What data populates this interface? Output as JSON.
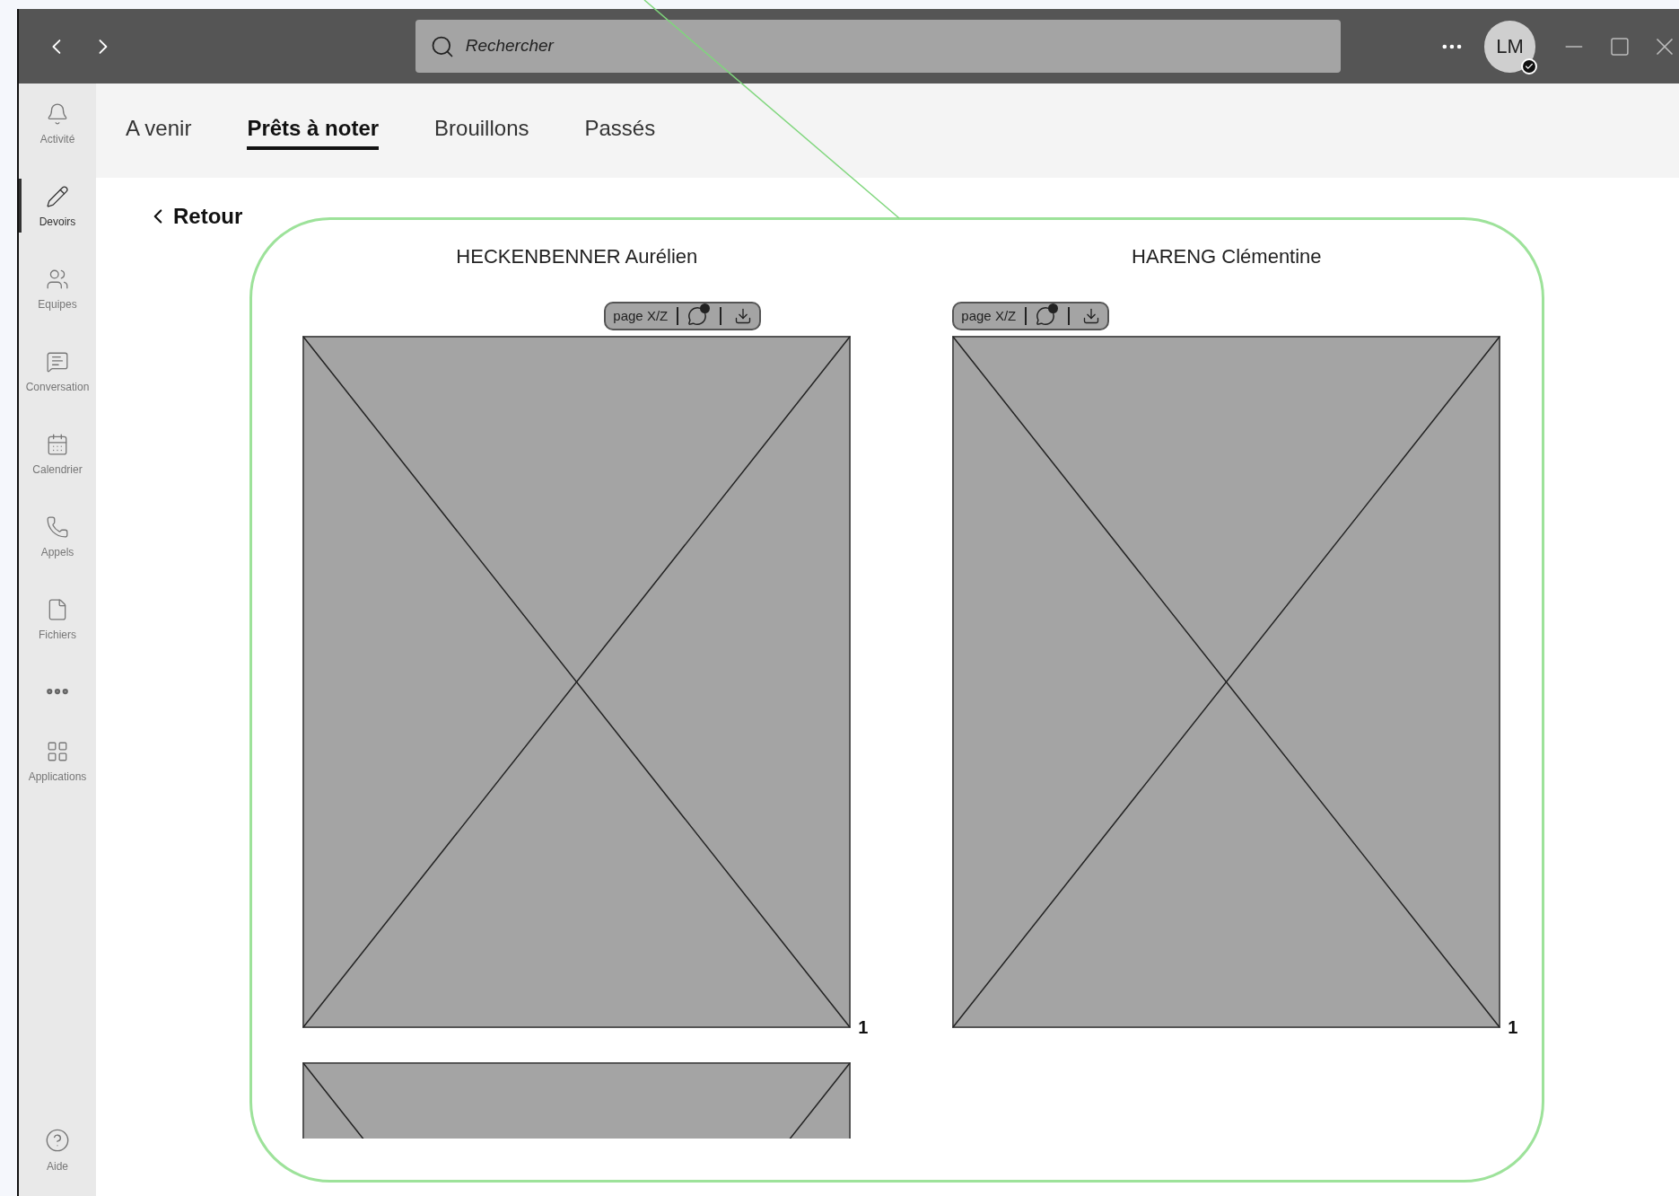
{
  "title_bar": {
    "search": {
      "placeholder": "Rechercher"
    },
    "avatar": {
      "initials": "LM"
    }
  },
  "sidebar": {
    "items": [
      {
        "label": "Activité",
        "selected": false
      },
      {
        "label": "Devoirs",
        "selected": true
      },
      {
        "label": "Equipes",
        "selected": false
      },
      {
        "label": "Conversation",
        "selected": false
      },
      {
        "label": "Calendrier",
        "selected": false
      },
      {
        "label": "Appels",
        "selected": false
      },
      {
        "label": "Fichiers",
        "selected": false
      }
    ],
    "more_items": [
      {
        "label": "Applications",
        "selected": false
      }
    ],
    "help": {
      "label": "Aide"
    }
  },
  "tabs": [
    {
      "label": "A venir",
      "selected": false
    },
    {
      "label": "Prêts à noter",
      "selected": true
    },
    {
      "label": "Brouillons",
      "selected": false
    },
    {
      "label": "Passés",
      "selected": false
    }
  ],
  "back": {
    "label": "Retour"
  },
  "submissions": [
    {
      "student": "HECKENBENNER Aurélien",
      "page_label": "page X/Z",
      "pages": [
        {
          "kind": "full",
          "number": "1"
        },
        {
          "kind": "partial"
        }
      ]
    },
    {
      "student": "HARENG Clémentine",
      "page_label": "page X/Z",
      "pages": [
        {
          "kind": "full",
          "number": "1"
        }
      ]
    }
  ]
}
